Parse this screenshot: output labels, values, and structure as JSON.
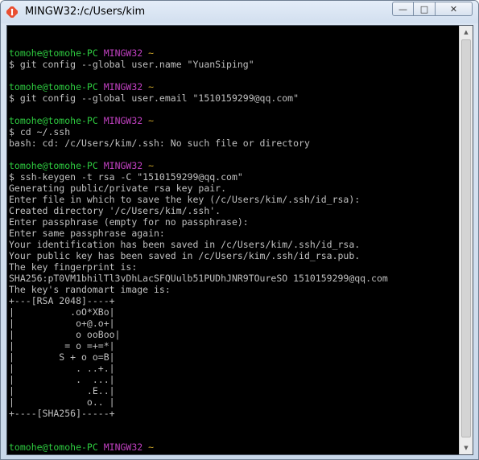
{
  "window": {
    "title": "MINGW32:/c/Users/kim",
    "app_icon": "mingw-git-icon",
    "controls": {
      "minimize_icon": "minimize-icon",
      "maximize_icon": "maximize-icon",
      "close_icon": "close-icon",
      "minimize_glyph": "—",
      "maximize_glyph": "□",
      "close_glyph": "✕"
    }
  },
  "colors": {
    "terminal_bg": "#000000",
    "terminal_fg": "#c0c0c0",
    "prompt_user": "#2ecc40",
    "prompt_host": "#c040c0",
    "prompt_path": "#c9a227"
  },
  "terminal": {
    "lines": [
      {
        "type": "blank"
      },
      {
        "type": "prompt",
        "user": "tomohe@tomohe-PC",
        "host": "MINGW32",
        "path": "~"
      },
      {
        "type": "text",
        "text": "$ git config --global user.name \"YuanSiping\""
      },
      {
        "type": "blank"
      },
      {
        "type": "prompt",
        "user": "tomohe@tomohe-PC",
        "host": "MINGW32",
        "path": "~"
      },
      {
        "type": "text",
        "text": "$ git config --global user.email \"1510159299@qq.com\""
      },
      {
        "type": "blank"
      },
      {
        "type": "prompt",
        "user": "tomohe@tomohe-PC",
        "host": "MINGW32",
        "path": "~"
      },
      {
        "type": "text",
        "text": "$ cd ~/.ssh"
      },
      {
        "type": "text",
        "text": "bash: cd: /c/Users/kim/.ssh: No such file or directory"
      },
      {
        "type": "blank"
      },
      {
        "type": "prompt",
        "user": "tomohe@tomohe-PC",
        "host": "MINGW32",
        "path": "~"
      },
      {
        "type": "text",
        "text": "$ ssh-keygen -t rsa -C \"1510159299@qq.com\""
      },
      {
        "type": "text",
        "text": "Generating public/private rsa key pair."
      },
      {
        "type": "text",
        "text": "Enter file in which to save the key (/c/Users/kim/.ssh/id_rsa):"
      },
      {
        "type": "text",
        "text": "Created directory '/c/Users/kim/.ssh'."
      },
      {
        "type": "text",
        "text": "Enter passphrase (empty for no passphrase):"
      },
      {
        "type": "text",
        "text": "Enter same passphrase again:"
      },
      {
        "type": "text",
        "text": "Your identification has been saved in /c/Users/kim/.ssh/id_rsa."
      },
      {
        "type": "text",
        "text": "Your public key has been saved in /c/Users/kim/.ssh/id_rsa.pub."
      },
      {
        "type": "text",
        "text": "The key fingerprint is:"
      },
      {
        "type": "text",
        "text": "SHA256:pT0VM1bhilTl3vDhLacSFQUulb51PUDhJNR9TOureSO 1510159299@qq.com"
      },
      {
        "type": "text",
        "text": "The key's randomart image is:"
      },
      {
        "type": "text",
        "text": "+---[RSA 2048]----+"
      },
      {
        "type": "text",
        "text": "|          .oO*XBo|"
      },
      {
        "type": "text",
        "text": "|           o+@.o+|"
      },
      {
        "type": "text",
        "text": "|           o ooBoo|"
      },
      {
        "type": "text",
        "text": "|         = o =+=*|"
      },
      {
        "type": "text",
        "text": "|        S + o o=B|"
      },
      {
        "type": "text",
        "text": "|           . ..+.|"
      },
      {
        "type": "text",
        "text": "|           .  ...|"
      },
      {
        "type": "text",
        "text": "|             .E..|"
      },
      {
        "type": "text",
        "text": "|             o.. |"
      },
      {
        "type": "text",
        "text": "+----[SHA256]-----+"
      },
      {
        "type": "blank"
      },
      {
        "type": "blank"
      },
      {
        "type": "prompt",
        "user": "tomohe@tomohe-PC",
        "host": "MINGW32",
        "path": "~"
      },
      {
        "type": "input",
        "text": "$ "
      }
    ]
  },
  "scrollbar": {
    "up_icon": "scroll-up-arrow-icon",
    "down_icon": "scroll-down-arrow-icon",
    "up_glyph": "▲",
    "down_glyph": "▼"
  }
}
